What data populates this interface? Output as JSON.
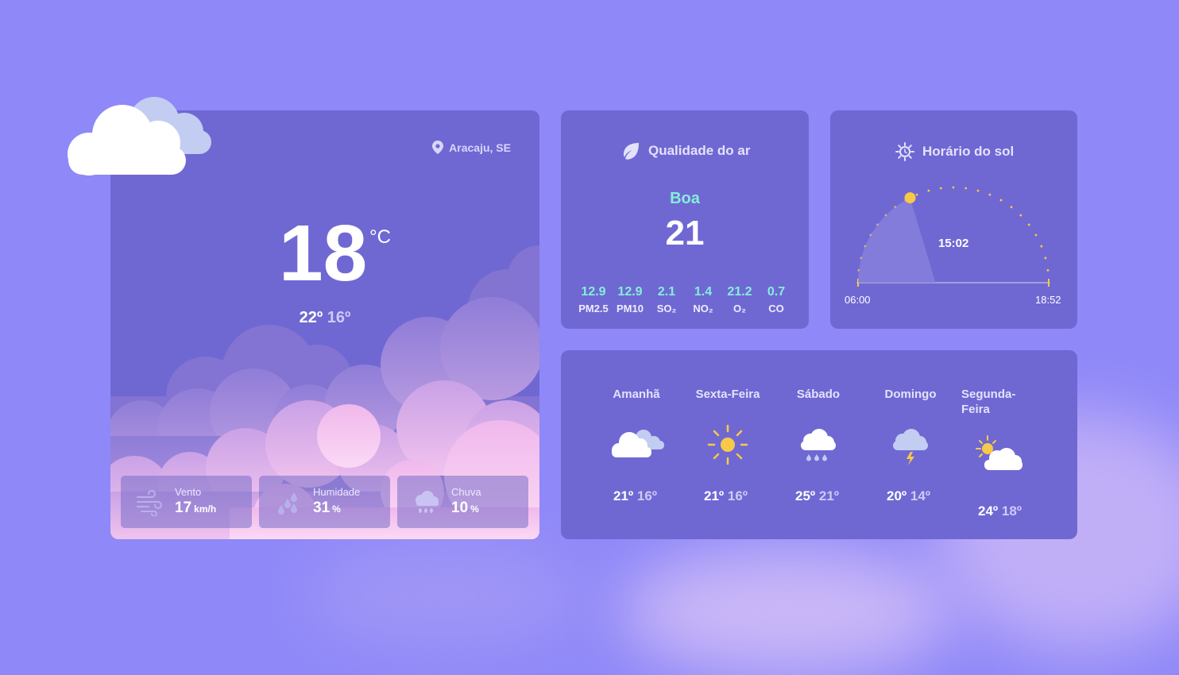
{
  "location": "Aracaju, SE",
  "current": {
    "temperature": "18",
    "unit": "°C",
    "high": "22º",
    "low": "16º"
  },
  "stats": [
    {
      "label": "Vento",
      "value": "17",
      "unit": "km/h",
      "icon": "wind-icon"
    },
    {
      "label": "Humidade",
      "value": "31",
      "unit": "%",
      "icon": "humidity-icon"
    },
    {
      "label": "Chuva",
      "value": "10",
      "unit": "%",
      "icon": "rain-cloud-icon"
    }
  ],
  "air_quality": {
    "title": "Qualidade do ar",
    "status": "Boa",
    "index": "21",
    "pollutants": [
      {
        "value": "12.9",
        "name": "PM2.5"
      },
      {
        "value": "12.9",
        "name": "PM10"
      },
      {
        "value": "2.1",
        "name": "SO₂"
      },
      {
        "value": "1.4",
        "name": "NO₂"
      },
      {
        "value": "21.2",
        "name": "O₂"
      },
      {
        "value": "0.7",
        "name": "CO"
      }
    ]
  },
  "sun": {
    "title": "Horário do sol",
    "sunrise": "06:00",
    "sunset": "18:52",
    "current_time": "15:02",
    "day_progress": 0.35
  },
  "forecast": [
    {
      "day": "Amanhã",
      "high": "21º",
      "low": "16º",
      "icon": "partly-cloudy-icon"
    },
    {
      "day": "Sexta-Feira",
      "high": "21º",
      "low": "16º",
      "icon": "sun-icon"
    },
    {
      "day": "Sábado",
      "high": "25º",
      "low": "21º",
      "icon": "rain-icon"
    },
    {
      "day": "Domingo",
      "high": "20º",
      "low": "14º",
      "icon": "thunderstorm-icon"
    },
    {
      "day": "Segunda-Feira",
      "high": "24º",
      "low": "18º",
      "icon": "sun-cloud-icon"
    }
  ],
  "colors": {
    "background": "#8e88f8",
    "card": "#6f68d3",
    "accent_teal": "#84efd8",
    "sun_yellow": "#f7c948"
  }
}
